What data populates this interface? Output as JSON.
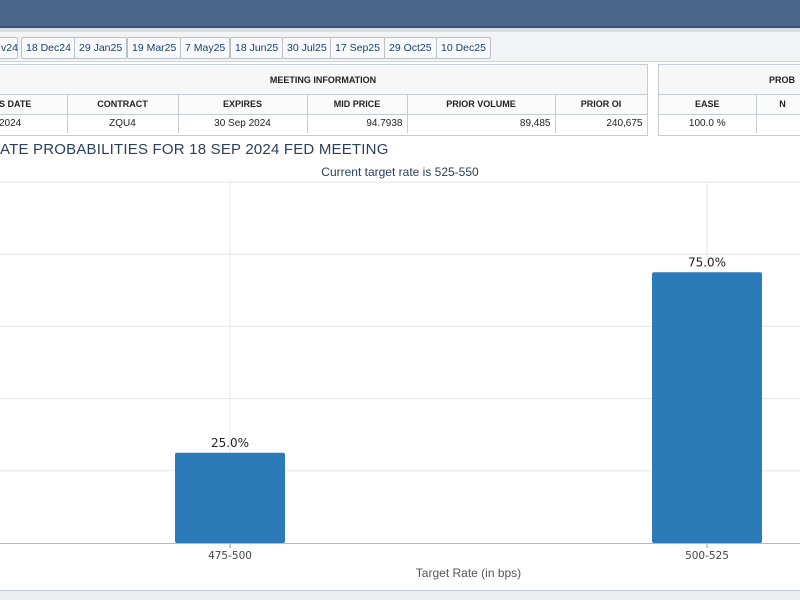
{
  "tabs": [
    "v24",
    "18 Dec24",
    "29 Jan25",
    "19 Mar25",
    "7 May25",
    "18 Jun25",
    "30 Jul25",
    "17 Sep25",
    "29 Oct25",
    "10 Dec25"
  ],
  "meeting_info": {
    "title": "MEETING INFORMATION",
    "headers": [
      "S DATE",
      "CONTRACT",
      "EXPIRES",
      "MID PRICE",
      "PRIOR VOLUME",
      "PRIOR OI"
    ],
    "values": [
      "2024",
      "ZQU4",
      "30 Sep 2024",
      "94.7938",
      "89,485",
      "240,675"
    ]
  },
  "probabilities_panel": {
    "title": "PROB",
    "headers": [
      "EASE",
      "N"
    ],
    "values": [
      "100.0 %",
      ""
    ]
  },
  "chart_data": {
    "type": "bar",
    "title": "ATE PROBABILITIES FOR 18 SEP 2024 FED MEETING",
    "subtitle": "Current target rate is 525-550",
    "xlabel": "Target Rate (in bps)",
    "ylabel": "",
    "categories": [
      "475-500",
      "500-525"
    ],
    "values": [
      25.0,
      75.0
    ],
    "data_labels": [
      "25.0%",
      "75.0%"
    ],
    "ylim": [
      0,
      100
    ],
    "grid": true,
    "bar_color": "#2b7bb9"
  }
}
